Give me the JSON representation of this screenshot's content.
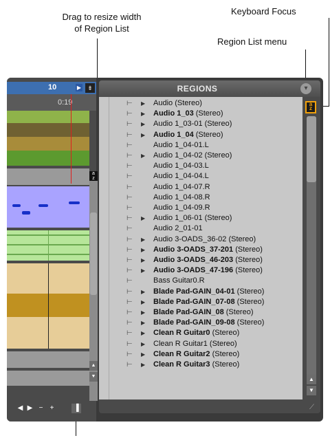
{
  "annotations": {
    "resize_width_line1": "Drag to resize width",
    "resize_width_line2": "of Region List",
    "keyboard_focus": "Keyboard Focus",
    "region_list_menu": "Region List menu"
  },
  "edit_window": {
    "counter": "10",
    "time": "0:19"
  },
  "region_list": {
    "title": "REGIONS",
    "keyboard_focus_glyph": "a z",
    "items": [
      {
        "name": "Audio",
        "suffix": " (Stereo)",
        "bold": false,
        "expandable": true
      },
      {
        "name": "Audio 1_03",
        "suffix": " (Stereo)",
        "bold": true,
        "expandable": true
      },
      {
        "name": "Audio 1_03-01",
        "suffix": " (Stereo)",
        "bold": false,
        "expandable": true
      },
      {
        "name": "Audio 1_04",
        "suffix": " (Stereo)",
        "bold": true,
        "expandable": true
      },
      {
        "name": "Audio 1_04-01.L",
        "suffix": "",
        "bold": false,
        "expandable": false
      },
      {
        "name": "Audio 1_04-02",
        "suffix": " (Stereo)",
        "bold": false,
        "expandable": true
      },
      {
        "name": "Audio 1_04-03.L",
        "suffix": "",
        "bold": false,
        "expandable": false
      },
      {
        "name": "Audio 1_04-04.L",
        "suffix": "",
        "bold": false,
        "expandable": false
      },
      {
        "name": "Audio 1_04-07.R",
        "suffix": "",
        "bold": false,
        "expandable": false
      },
      {
        "name": "Audio 1_04-08.R",
        "suffix": "",
        "bold": false,
        "expandable": false
      },
      {
        "name": "Audio 1_04-09.R",
        "suffix": "",
        "bold": false,
        "expandable": false
      },
      {
        "name": "Audio 1_06-01",
        "suffix": " (Stereo)",
        "bold": false,
        "expandable": true
      },
      {
        "name": "Audio 2_01-01",
        "suffix": "",
        "bold": false,
        "expandable": false
      },
      {
        "name": "Audio 3-OADS_36-02",
        "suffix": " (Stereo)",
        "bold": false,
        "expandable": true
      },
      {
        "name": "Audio 3-OADS_37-201",
        "suffix": " (Stereo)",
        "bold": true,
        "expandable": true
      },
      {
        "name": "Audio 3-OADS_46-203",
        "suffix": " (Stereo)",
        "bold": true,
        "expandable": true
      },
      {
        "name": "Audio 3-OADS_47-196",
        "suffix": " (Stereo)",
        "bold": true,
        "expandable": true
      },
      {
        "name": "Bass Guitar0.R",
        "suffix": "",
        "bold": false,
        "expandable": false
      },
      {
        "name": "Blade Pad-GAIN_04-01",
        "suffix": " (Stereo)",
        "bold": true,
        "expandable": true
      },
      {
        "name": "Blade Pad-GAIN_07-08",
        "suffix": " (Stereo)",
        "bold": true,
        "expandable": true
      },
      {
        "name": "Blade Pad-GAIN_08",
        "suffix": " (Stereo)",
        "bold": true,
        "expandable": true
      },
      {
        "name": "Blade Pad-GAIN_09-08",
        "suffix": " (Stereo)",
        "bold": true,
        "expandable": true
      },
      {
        "name": "Clean R Guitar0",
        "suffix": " (Stereo)",
        "bold": true,
        "expandable": true
      },
      {
        "name": "Clean R Guitar1",
        "suffix": " (Stereo)",
        "bold": false,
        "expandable": true
      },
      {
        "name": "Clean R Guitar2",
        "suffix": " (Stereo)",
        "bold": true,
        "expandable": true
      },
      {
        "name": "Clean R Guitar3",
        "suffix": " (Stereo)",
        "bold": true,
        "expandable": true
      }
    ]
  },
  "colors": {
    "keyboard_focus": "#f2a20c",
    "playhead": "#e01e1e",
    "track_green": "#8fb34a",
    "track_olive": "#6f6132",
    "track_purple": "#a9a3ff",
    "track_light_green": "#b7e69a",
    "track_waveform": "#e7cd98"
  },
  "icons": {
    "region_icon": "region-audio-icon",
    "expand_arrow": "expand-triangle-icon",
    "menu_button": "menu-circle-icon"
  }
}
